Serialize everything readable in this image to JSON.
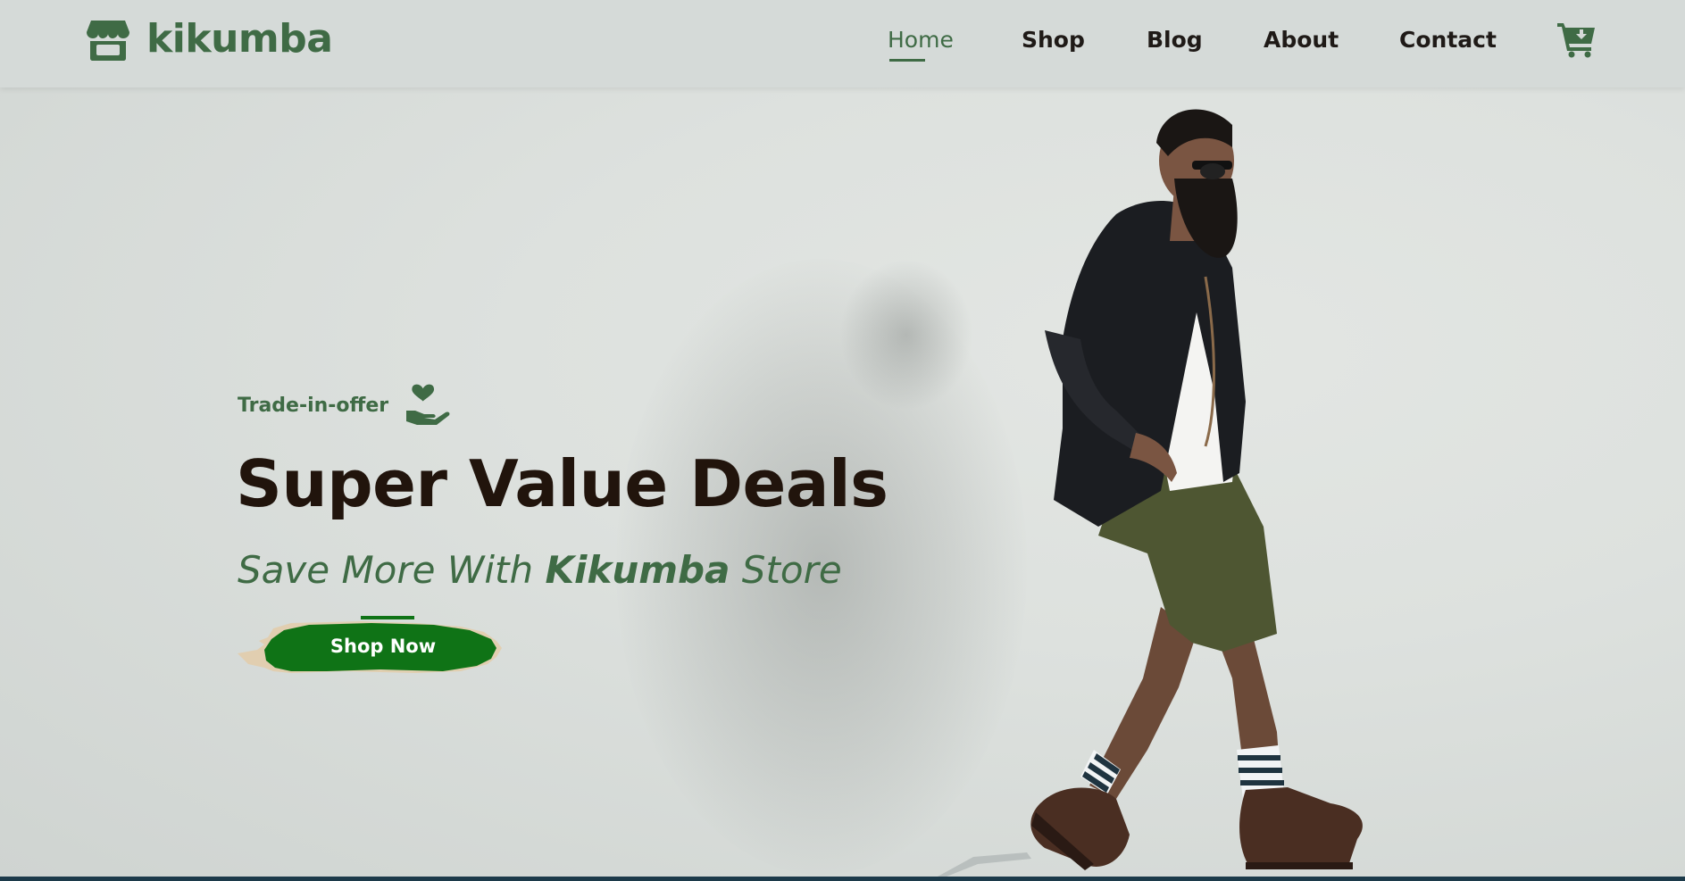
{
  "brand": {
    "name": "kikumba",
    "color": "#3f6b45",
    "icon": "storefront-icon"
  },
  "nav": {
    "items": [
      {
        "label": "Home",
        "active": true
      },
      {
        "label": "Shop",
        "active": false
      },
      {
        "label": "Blog",
        "active": false
      },
      {
        "label": "About",
        "active": false
      },
      {
        "label": "Contact",
        "active": false
      }
    ],
    "cart_icon": "shopping-cart-icon"
  },
  "hero": {
    "offer": "Trade-in-offer",
    "offer_icon": "heart-hand-icon",
    "title": "Super Value Deals",
    "subtitle_before": "Save More With ",
    "subtitle_brand": "Kikumba",
    "subtitle_after": " Store",
    "cta": "Shop Now",
    "cta_color": "#0f7316",
    "title_color": "#21140c"
  }
}
